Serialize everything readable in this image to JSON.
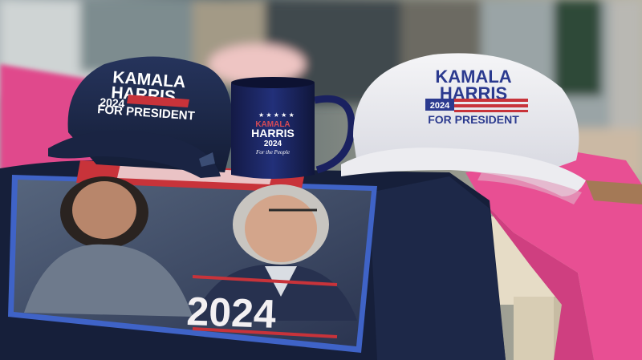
{
  "scene": {
    "description_items": [
      "navy-cap",
      "navy-mug",
      "white-cap",
      "navy-shirt",
      "pink-shirts",
      "table"
    ]
  },
  "navy_cap": {
    "line1": "KAMALA",
    "line2": "HARRIS",
    "line3": "2024",
    "line4": "FOR PRESIDENT"
  },
  "mug": {
    "line1": "KAMALA",
    "line2": "HARRIS",
    "line3": "2024",
    "line4": "For the People"
  },
  "white_cap": {
    "line1": "KAMALA",
    "line2": "HARRIS",
    "line3": "2024",
    "line4": "FOR PRESIDENT"
  },
  "shirt": {
    "year": "2024"
  },
  "colors": {
    "navy": "#1c2747",
    "cap_text_navy": "#ffffff",
    "white_cap_text": "#2b3a8f",
    "flag_red": "#c8333a",
    "pink": "#e84f93",
    "table": "#e6dcc6",
    "shirt_border": "#3f63c7"
  }
}
